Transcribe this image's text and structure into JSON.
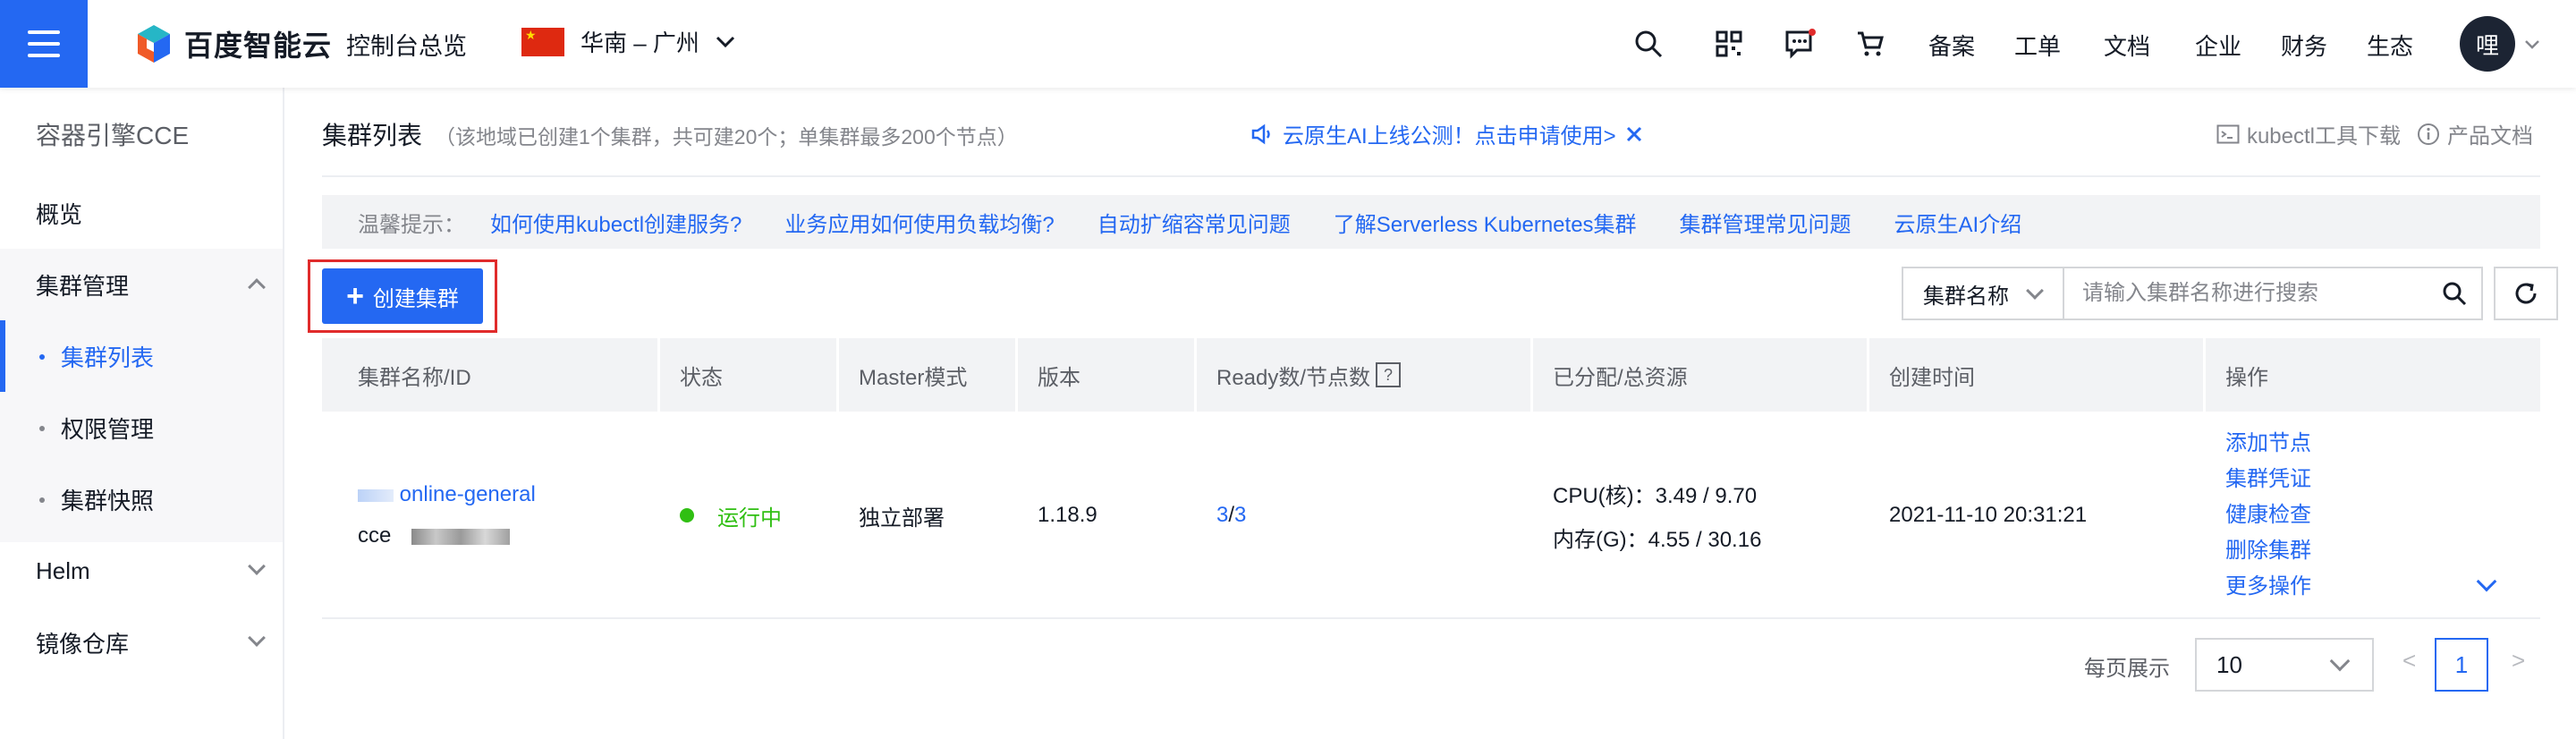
{
  "header": {
    "brand": "百度智能云",
    "console": "控制台总览",
    "region": "华南 – 广州",
    "nav": [
      "备案",
      "工单",
      "文档",
      "企业",
      "财务",
      "生态"
    ],
    "avatar_text": "哩",
    "accent_color": "#2468f2"
  },
  "sidebar": {
    "title": "容器引擎CCE",
    "items": [
      {
        "label": "概览"
      },
      {
        "label": "集群管理"
      },
      {
        "label": "集群列表"
      },
      {
        "label": "权限管理"
      },
      {
        "label": "集群快照"
      },
      {
        "label": "Helm"
      },
      {
        "label": "镜像仓库"
      }
    ]
  },
  "main": {
    "title": "集群列表",
    "subtitle": "（该地域已创建1个集群，共可建20个；单集群最多200个节点）",
    "banner": "云原生AI上线公测！点击申请使用>",
    "tools": [
      "kubectl工具下载",
      "产品文档"
    ],
    "tips_label": "温馨提示：",
    "tips": [
      "如何使用kubectl创建服务?",
      "业务应用如何使用负载均衡?",
      "自动扩缩容常见问题",
      "了解Serverless Kubernetes集群",
      "集群管理常见问题",
      "云原生AI介绍"
    ],
    "create_button": "创建集群",
    "search": {
      "select": "集群名称",
      "placeholder": "请输入集群名称进行搜索"
    }
  },
  "table": {
    "columns": [
      "集群名称/ID",
      "状态",
      "Master模式",
      "版本",
      "Ready数/节点数",
      "已分配/总资源",
      "创建时间",
      "操作"
    ],
    "rows": [
      {
        "name": "online-general",
        "id_prefix": "cce",
        "status": "运行中",
        "master_mode": "独立部署",
        "version": "1.18.9",
        "ready": "3",
        "nodes": "3",
        "cpu": "CPU(核)：3.49 / 9.70",
        "mem": "内存(G)：4.55 / 30.16",
        "created": "2021-11-10 20:31:21",
        "ops": [
          "添加节点",
          "集群凭证",
          "健康检查",
          "删除集群",
          "更多操作"
        ]
      }
    ]
  },
  "pager": {
    "label": "每页展示",
    "page_size": "10",
    "prev": "<",
    "page": "1",
    "next": ">"
  }
}
